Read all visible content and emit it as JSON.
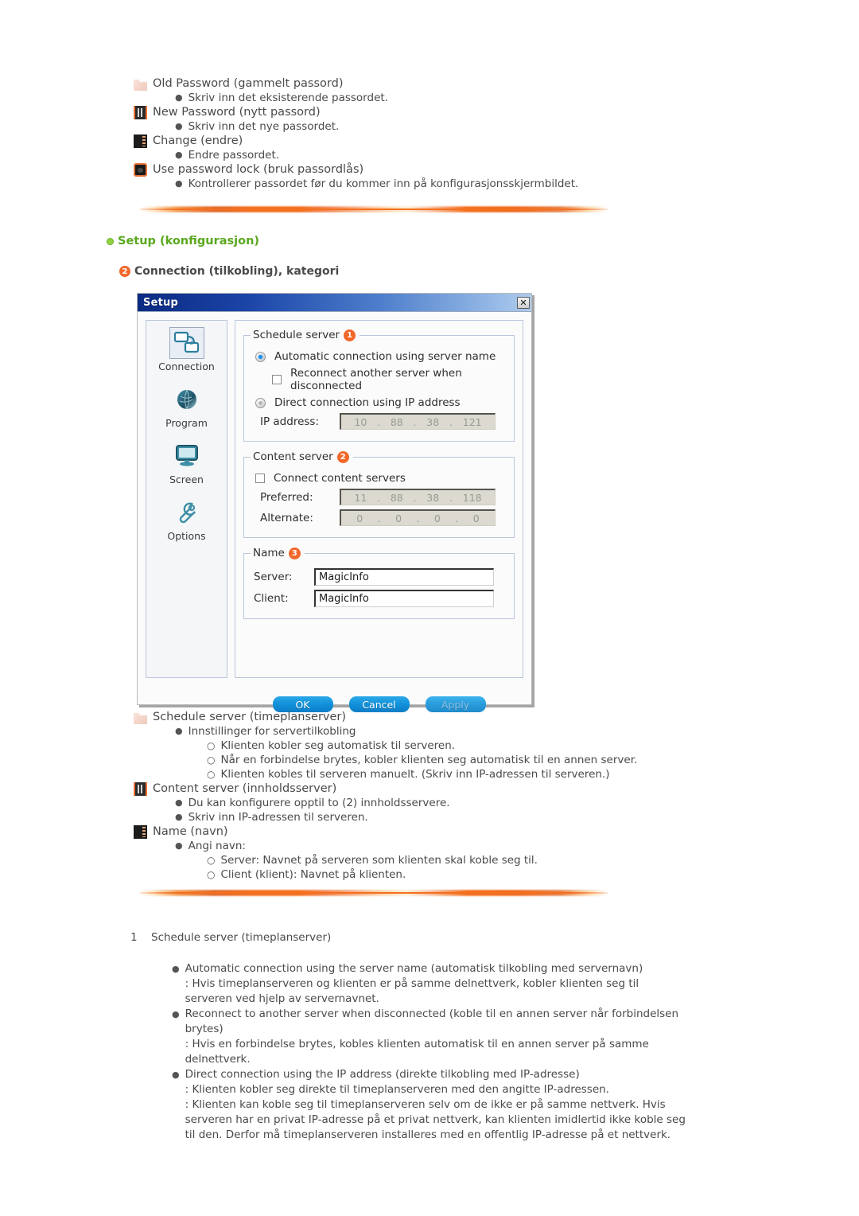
{
  "top_list": [
    {
      "icon": "folder-icon",
      "text": "Old Password (gammelt passord)",
      "bullets": [
        "Skriv inn det eksisterende passordet."
      ]
    },
    {
      "icon": "film-icon",
      "text": "New Password (nytt passord)",
      "bullets": [
        "Skriv inn det nye passordet."
      ]
    },
    {
      "icon": "book-icon",
      "text": "Change (endre)",
      "bullets": [
        "Endre passordet."
      ]
    },
    {
      "icon": "globe-icon",
      "text": "Use password lock (bruk passordlås)",
      "bullets": [
        "Kontrollerer passordet før du kommer inn på konfigurasjonsskjermbildet."
      ]
    }
  ],
  "section": {
    "green_header": "Setup (konfigurasjon)",
    "sub_header": "Connection (tilkobling), kategori",
    "sub_header_badge": "2"
  },
  "dialog": {
    "title": "Setup",
    "close_label": "✕",
    "nav": [
      {
        "label": "Connection",
        "icon": "connection-icon",
        "selected": true
      },
      {
        "label": "Program",
        "icon": "globe-icon",
        "selected": false
      },
      {
        "label": "Screen",
        "icon": "monitor-icon",
        "selected": false
      },
      {
        "label": "Options",
        "icon": "wrench-icon",
        "selected": false
      }
    ],
    "schedule_server": {
      "legend": "Schedule server",
      "badge": "1",
      "radio_auto": "Automatic connection using server name",
      "checkbox_reconnect": "Reconnect another server when disconnected",
      "radio_direct": "Direct connection using IP address",
      "ip_label": "IP address:",
      "ip_value": [
        "10",
        "88",
        "38",
        "121"
      ]
    },
    "content_server": {
      "legend": "Content server",
      "badge": "2",
      "checkbox_connect": "Connect content servers",
      "preferred_label": "Preferred:",
      "preferred_value": [
        "11",
        "88",
        "38",
        "118"
      ],
      "alternate_label": "Alternate:",
      "alternate_value": [
        "0",
        "0",
        "0",
        "0"
      ]
    },
    "name_group": {
      "legend": "Name",
      "badge": "3",
      "server_label": "Server:",
      "server_value": "MagicInfo",
      "client_label": "Client:",
      "client_value": "MagicInfo"
    },
    "buttons": {
      "ok": "OK",
      "cancel": "Cancel",
      "apply": "Apply"
    }
  },
  "mid_list": [
    {
      "icon": "folder-icon",
      "text": "Schedule server (timeplanserver)",
      "bullets": [
        {
          "text": "Innstillinger for servertilkobling",
          "subs": [
            "Klienten kobler seg automatisk til serveren.",
            "Når en forbindelse brytes, kobler klienten seg automatisk til en annen server.",
            "Klienten kobles til serveren manuelt. (Skriv inn IP-adressen til serveren.)"
          ]
        }
      ]
    },
    {
      "icon": "film-icon",
      "text": "Content server (innholdsserver)",
      "bullets": [
        {
          "text": "Du kan konfigurere opptil to (2) innholdsservere.",
          "subs": []
        },
        {
          "text": "Skriv inn IP-adressen til serveren.",
          "subs": []
        }
      ]
    },
    {
      "icon": "book-icon",
      "text": "Name (navn)",
      "bullets": [
        {
          "text": "Angi navn:",
          "subs": [
            "Server: Navnet på serveren som klienten skal koble seg til.",
            "Client (klient): Navnet på klienten."
          ]
        }
      ]
    }
  ],
  "bottom": {
    "number": "1",
    "title": "Schedule server (timeplanserver)",
    "items": [
      {
        "head": "Automatic connection using the server name (automatisk tilkobling med servernavn)",
        "lines": [
          ": Hvis timeplanserveren og klienten er på samme delnettverk, kobler klienten seg til serveren ved hjelp av servernavnet."
        ]
      },
      {
        "head": "Reconnect to another server when disconnected (koble til en annen server når forbindelsen brytes)",
        "lines": [
          ": Hvis en forbindelse brytes, kobles klienten automatisk til en annen server på samme delnettverk."
        ]
      },
      {
        "head": "Direct connection using the IP address (direkte tilkobling med IP-adresse)",
        "lines": [
          ": Klienten kobler seg direkte til timeplanserveren med den angitte IP-adressen.",
          ": Klienten kan koble seg til timeplanserveren selv om de ikke er på samme nettverk. Hvis serveren har en privat IP-adresse på et privat nettverk, kan klienten imidlertid ikke koble seg til den. Derfor må timeplanserveren installeres med en offentlig IP-adresse på et nettverk."
        ]
      }
    ]
  },
  "colors": {
    "accent_orange": "#f2682a",
    "header_green": "#5aa81e",
    "dialog_title_blue": "#0b2a82",
    "button_blue": "#1290da"
  }
}
